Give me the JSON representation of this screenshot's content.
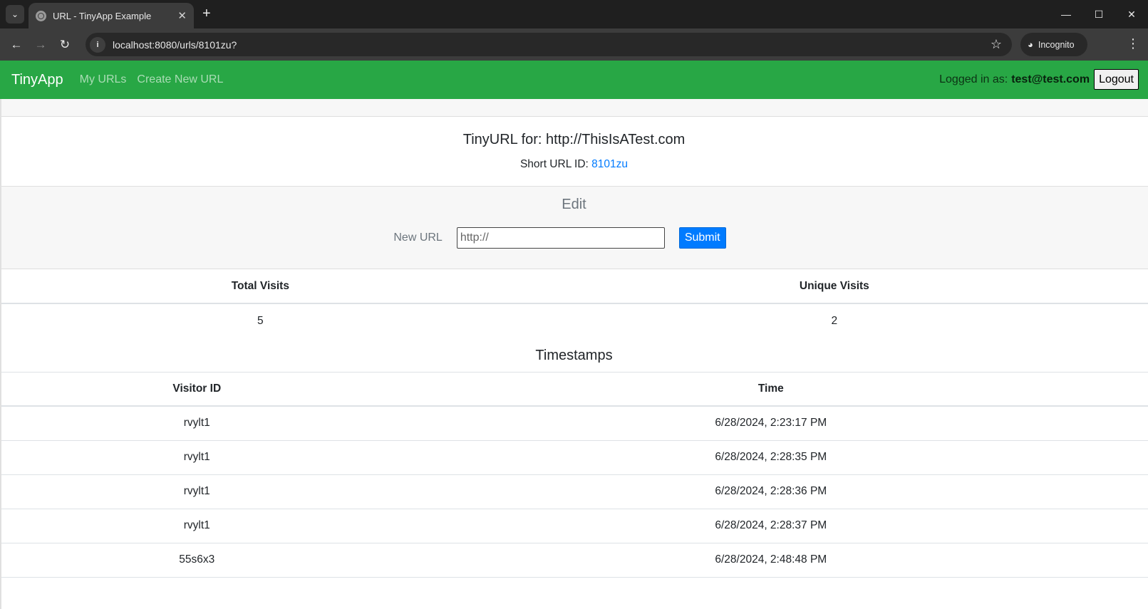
{
  "browser": {
    "tab_title": "URL - TinyApp Example",
    "url": "localhost:8080/urls/8101zu?",
    "incognito_label": "Incognito"
  },
  "navbar": {
    "brand": "TinyApp",
    "links": [
      "My URLs",
      "Create New URL"
    ],
    "logged_in_prefix": "Logged in as:",
    "user_email": "test@test.com",
    "logout_label": "Logout",
    "color": "#28a745"
  },
  "url_card": {
    "title": "TinyURL for: http://ThisIsATest.com",
    "short_id_label": "Short URL ID:",
    "short_id": "8101zu"
  },
  "edit": {
    "title": "Edit",
    "label": "New URL",
    "input_value": "http://",
    "submit_label": "Submit"
  },
  "visits": {
    "headers": [
      "Total Visits",
      "Unique Visits"
    ],
    "total": "5",
    "unique": "2"
  },
  "timestamps": {
    "title": "Timestamps",
    "headers": [
      "Visitor ID",
      "Time"
    ],
    "rows": [
      {
        "visitor": "rvylt1",
        "time": "6/28/2024, 2:23:17 PM"
      },
      {
        "visitor": "rvylt1",
        "time": "6/28/2024, 2:28:35 PM"
      },
      {
        "visitor": "rvylt1",
        "time": "6/28/2024, 2:28:36 PM"
      },
      {
        "visitor": "rvylt1",
        "time": "6/28/2024, 2:28:37 PM"
      },
      {
        "visitor": "55s6x3",
        "time": "6/28/2024, 2:48:48 PM"
      }
    ]
  }
}
